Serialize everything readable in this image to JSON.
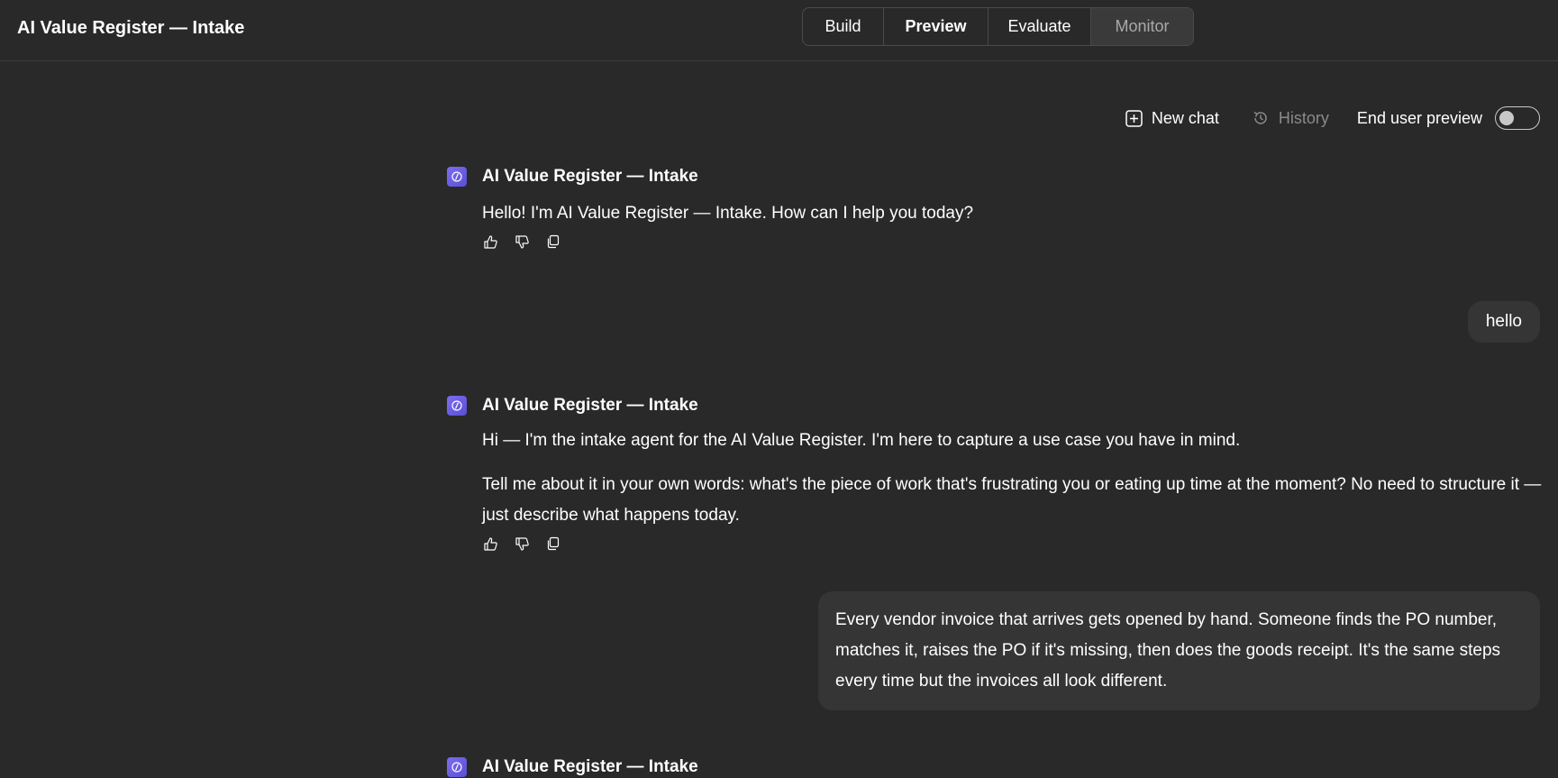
{
  "header": {
    "title": "AI Value Register — Intake",
    "tabs": [
      {
        "label": "Build"
      },
      {
        "label": "Preview",
        "active": true
      },
      {
        "label": "Evaluate"
      },
      {
        "label": "Monitor",
        "disabled": true
      }
    ]
  },
  "toolbar": {
    "new_chat": "New chat",
    "history": "History",
    "end_user_preview": "End user preview",
    "end_user_preview_on": false
  },
  "chat": {
    "agent_name": "AI Value Register — Intake",
    "messages": [
      {
        "role": "bot",
        "paragraphs": [
          "Hello! I'm AI Value Register — Intake. How can I help you today?"
        ]
      },
      {
        "role": "user",
        "text": "hello"
      },
      {
        "role": "bot",
        "paragraphs": [
          "Hi — I'm the intake agent for the AI Value Register. I'm here to capture a use case you have in mind.",
          "Tell me about it in your own words: what's the piece of work that's frustrating you or eating up time at the moment? No need to structure it — just describe what happens today."
        ]
      },
      {
        "role": "user",
        "text": "Every vendor invoice that arrives gets opened by hand. Someone finds the PO number, matches it, raises the PO if it's missing, then does the goods receipt. It's the same steps every time but the invoices all look different."
      }
    ]
  },
  "colors": {
    "background": "#292929",
    "user_bubble": "#353535",
    "avatar_accent": "#6b5ce7"
  },
  "icons": {
    "new_chat": "plus-square-icon",
    "history": "history-icon",
    "like": "thumbs-up-icon",
    "dislike": "thumbs-down-icon",
    "copy": "copy-icon",
    "avatar": "agent-avatar-icon"
  }
}
